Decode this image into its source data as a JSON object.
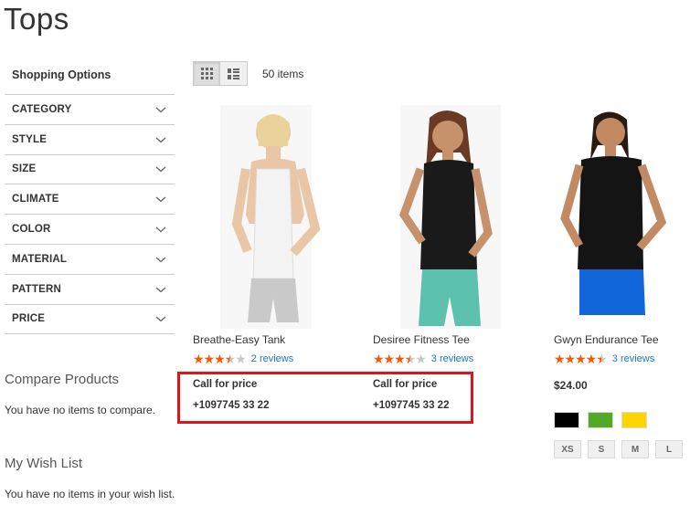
{
  "page": {
    "title": "Tops"
  },
  "sidebar": {
    "title": "Shopping Options",
    "filters": [
      {
        "label": "CATEGORY"
      },
      {
        "label": "STYLE"
      },
      {
        "label": "SIZE"
      },
      {
        "label": "CLIMATE"
      },
      {
        "label": "COLOR"
      },
      {
        "label": "MATERIAL"
      },
      {
        "label": "PATTERN"
      },
      {
        "label": "PRICE"
      }
    ]
  },
  "compare": {
    "title": "Compare Products",
    "empty_text": "You have no items to compare."
  },
  "wishlist": {
    "title": "My Wish List",
    "empty_text": "You have no items in your wish list."
  },
  "toolbar": {
    "amount": "50 items",
    "modes": [
      "grid-icon",
      "list-icon"
    ],
    "active_mode": "grid"
  },
  "products": [
    {
      "name": "Breathe-Easy Tank",
      "rating": 3.5,
      "reviews": "2 reviews",
      "call_for_price": "Call for price",
      "phone": "+1097745 33 22"
    },
    {
      "name": "Desiree Fitness Tee",
      "rating": 3.5,
      "reviews": "3 reviews",
      "call_for_price": "Call for price",
      "phone": "+1097745 33 22"
    },
    {
      "name": "Gwyn Endurance Tee",
      "rating": 4.5,
      "reviews": "3 reviews",
      "price": "$24.00",
      "swatches": [
        "#000000",
        "#53a828",
        "#ffd500"
      ],
      "sizes": [
        "XS",
        "S",
        "M",
        "L"
      ]
    }
  ],
  "colors": {
    "accent_star": "#ff5501",
    "link": "#1979c3",
    "highlight": "#e2121a"
  }
}
